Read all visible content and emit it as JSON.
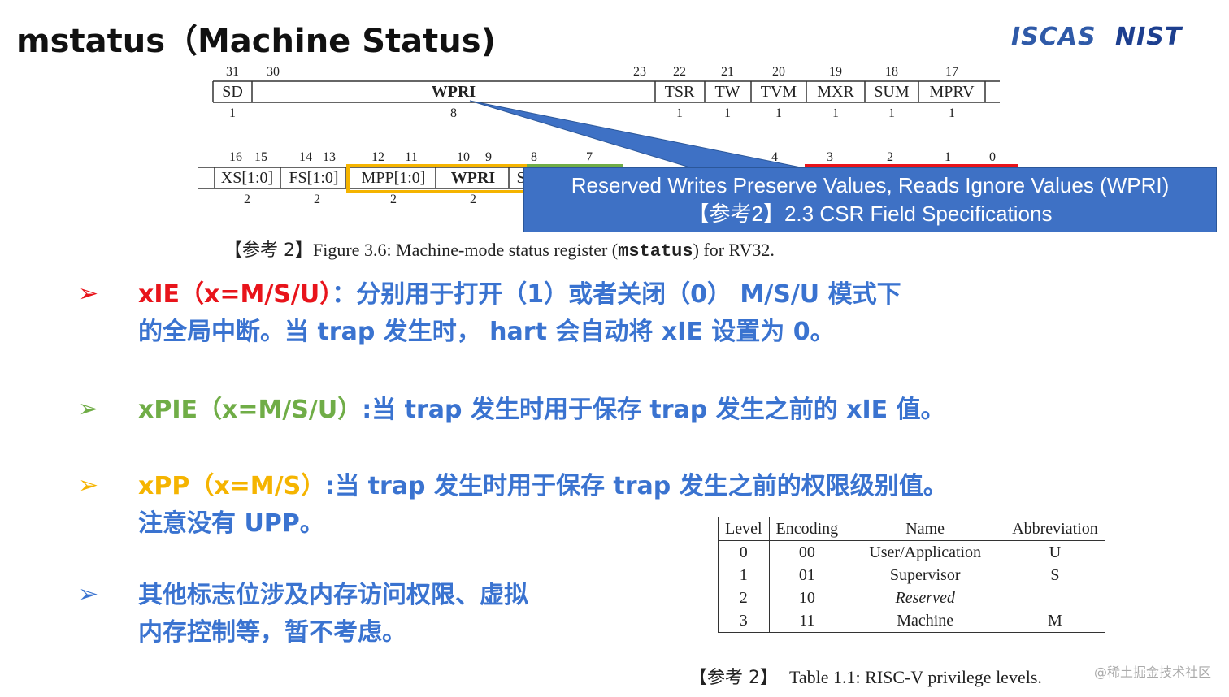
{
  "title": "mstatus（Machine Status)",
  "logos": {
    "iscas": "ISCAS",
    "nist": "NIST"
  },
  "register_row1": {
    "bits": [
      "31",
      "30",
      "23",
      "22",
      "21",
      "20",
      "19",
      "18",
      "17"
    ],
    "fields": [
      "SD",
      "WPRI",
      "TSR",
      "TW",
      "TVM",
      "MXR",
      "SUM",
      "MPRV"
    ],
    "widths": [
      "1",
      "8",
      "1",
      "1",
      "1",
      "1",
      "1",
      "1"
    ]
  },
  "register_row2": {
    "bits": [
      "16",
      "15",
      "14",
      "13",
      "12",
      "11",
      "10",
      "9",
      "8",
      "7",
      "4",
      "3",
      "2",
      "1",
      "0"
    ],
    "fields": [
      "XS[1:0]",
      "FS[1:0]",
      "MPP[1:0]",
      "WPRI",
      "S"
    ],
    "widths": [
      "2",
      "2",
      "2",
      "2"
    ]
  },
  "callout": {
    "line1": "Reserved Writes Preserve Values, Reads Ignore Values (WPRI)",
    "line2": "【参考2】2.3 CSR Field Specifications"
  },
  "figure_caption": {
    "ref": "【参考 2】",
    "text": "Figure 3.6: Machine-mode status register (",
    "code": "mstatus",
    "tail": ") for RV32."
  },
  "bullets": [
    {
      "arrow": "➢",
      "key": "xIE（x=M/S/U）",
      "line1": "：分别用于打开（1）或者关闭（0） M/S/U 模式下",
      "line2": "的全局中断。当 trap 发生时， hart 会自动将 xIE 设置为 0。",
      "key_color": "#e8141b",
      "text_color": "#3a73d0"
    },
    {
      "arrow": "➢",
      "key": "xPIE（x=M/S/U）",
      "line1": ":当 trap 发生时用于保存 trap 发生之前的 xIE 值。",
      "key_color": "#70ad47",
      "text_color": "#3a73d0"
    },
    {
      "arrow": "➢",
      "key": "xPP（x=M/S）",
      "line1": ":当 trap 发生时用于保存 trap 发生之前的权限级别值。",
      "line2": "注意没有 UPP。",
      "key_color": "#f5b400",
      "text_color": "#3a73d0"
    },
    {
      "arrow": "➢",
      "line1": "其他标志位涉及内存访问权限、虚拟",
      "line2": "内存控制等，暂不考虑。",
      "text_color": "#3a73d0"
    }
  ],
  "priv_table": {
    "headers": [
      "Level",
      "Encoding",
      "Name",
      "Abbreviation"
    ],
    "rows": [
      [
        "0",
        "00",
        "User/Application",
        "U"
      ],
      [
        "1",
        "01",
        "Supervisor",
        "S"
      ],
      [
        "2",
        "10",
        "Reserved",
        ""
      ],
      [
        "3",
        "11",
        "Machine",
        "M"
      ]
    ]
  },
  "table_caption": {
    "ref": "【参考 2】",
    "text": "Table 1.1: RISC-V privilege levels."
  },
  "watermark": "@稀土掘金技术社区"
}
